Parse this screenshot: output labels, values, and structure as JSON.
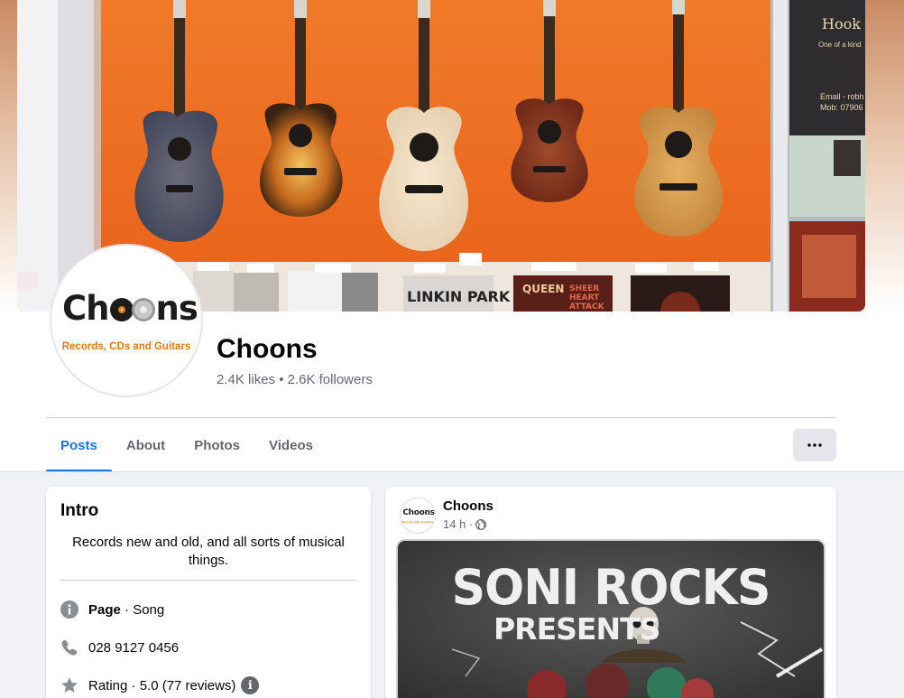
{
  "page": {
    "name": "Choons",
    "stats": "2.4K likes • 2.6K followers",
    "logo_word_start": "Ch",
    "logo_word_end": "ns",
    "logo_tagline": "Records, CDs and Guitars"
  },
  "cover": {
    "shelf_labels": [
      "LINKIN PARK",
      "QUEEN",
      "SHEER HEART ATTACK"
    ],
    "side_poster_text": [
      "Hook G",
      "One of a kind",
      "Email - robh",
      "Mob: 07906"
    ]
  },
  "tabs": [
    {
      "label": "Posts",
      "active": true
    },
    {
      "label": "About"
    },
    {
      "label": "Photos"
    },
    {
      "label": "Videos"
    }
  ],
  "more_button_label": "•••",
  "intro": {
    "title": "Intro",
    "bio": "Records new and old, and all sorts of musical things.",
    "rows": [
      {
        "icon": "info-icon",
        "bold": "Page",
        "text": " · Song"
      },
      {
        "icon": "phone-icon",
        "text": "028 9127 0456"
      },
      {
        "icon": "star-icon",
        "text": "Rating · 5.0 (77 reviews)",
        "badge": "i"
      }
    ]
  },
  "post": {
    "author": "Choons",
    "time": "14 h ·",
    "privacy_icon": "globe-icon",
    "avatar_word": "Choons",
    "avatar_tagline": "Records, CDs and Guitars",
    "poster_title": "SONI ROCKS",
    "poster_subtitle": "PRESENTS"
  },
  "colors": {
    "accent": "#1b74e4",
    "cover_wall": "#ee6a1e",
    "logo_orange": "#e07b16",
    "secondary_text": "#65676b",
    "background": "#f0f2f5"
  }
}
